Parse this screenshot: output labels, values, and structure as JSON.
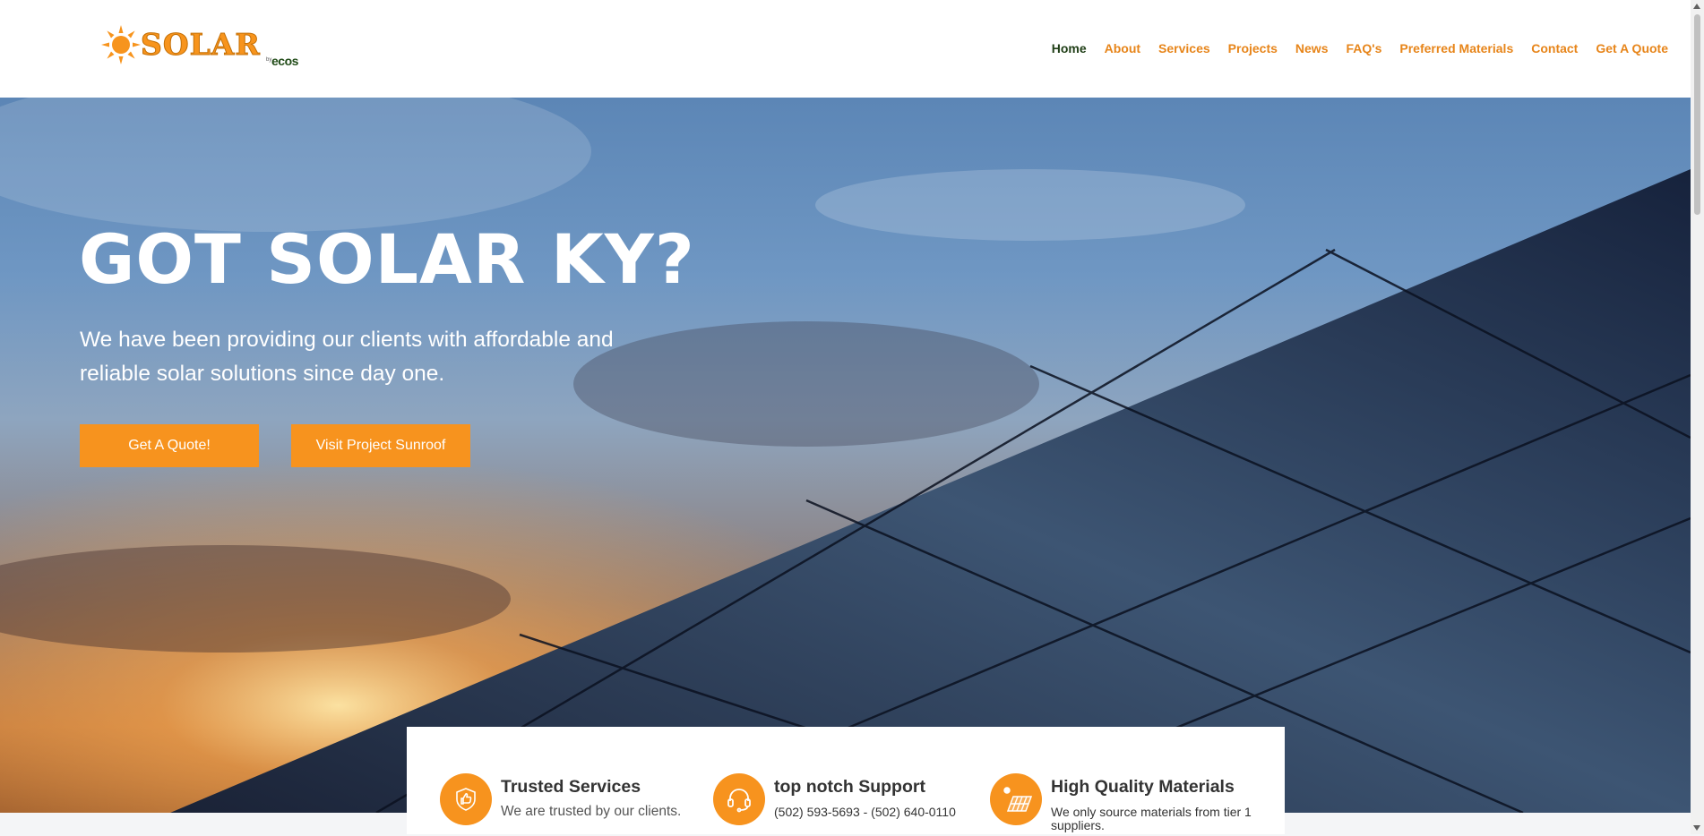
{
  "header": {
    "logo": {
      "word": "SOLAR",
      "by": "by",
      "ecos": "ecos"
    },
    "nav": [
      {
        "label": "Home"
      },
      {
        "label": "About"
      },
      {
        "label": "Services"
      },
      {
        "label": "Projects"
      },
      {
        "label": "News"
      },
      {
        "label": "FAQ's"
      },
      {
        "label": "Preferred Materials"
      },
      {
        "label": "Contact"
      },
      {
        "label": "Get A Quote"
      }
    ]
  },
  "hero": {
    "title": "GOT SOLAR KY?",
    "subtitle": "We have been providing our clients with affordable and reliable solar solutions since day one.",
    "buttons": {
      "quote": "Get A Quote!",
      "sunroof": "Visit Project Sunroof"
    }
  },
  "features": [
    {
      "title": "Trusted Services",
      "text": "We are trusted by our clients.",
      "icon": "shield-thumbs-up-icon"
    },
    {
      "title": "top notch Support",
      "text": "(502) 593-5693 - (502) 640-0110",
      "icon": "headset-icon"
    },
    {
      "title": "High Quality Materials",
      "text": "We only source materials from tier 1 suppliers.",
      "icon": "solar-panel-icon"
    }
  ],
  "colors": {
    "accent": "#f7931e",
    "nav_active": "#1f3e16",
    "nav": "#e7851a"
  }
}
